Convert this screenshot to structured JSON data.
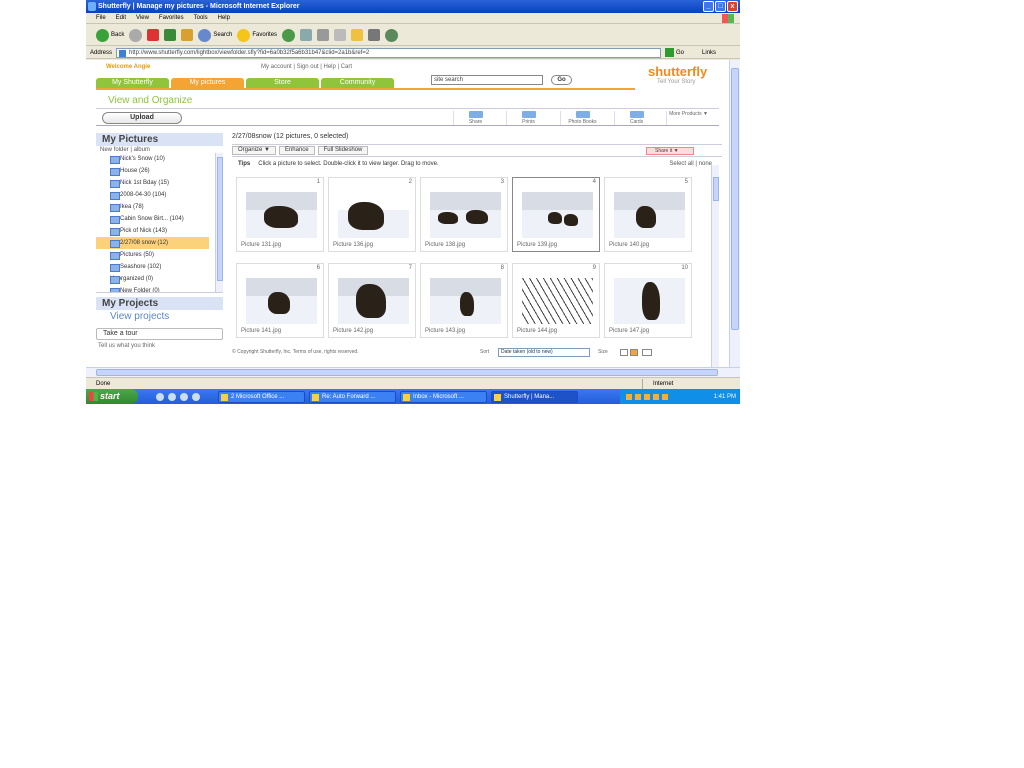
{
  "window": {
    "title": "Shutterfly | Manage my pictures - Microsoft Internet Explorer",
    "minimize": "_",
    "maximize": "□",
    "close": "x"
  },
  "menu": [
    "File",
    "Edit",
    "View",
    "Favorites",
    "Tools",
    "Help"
  ],
  "toolbar": {
    "back": "Back",
    "search": "Search",
    "favorites": "Favorites"
  },
  "address": {
    "label": "Address",
    "url": "http://www.shutterfly.com/lightbox/viewfolder.sfly?fid=6a0b32f5a6b31b47&clid=2a1b&ref=2",
    "go": "Go",
    "links": "Links"
  },
  "page": {
    "welcome": "Welcome Angie",
    "account_links": "My account | Sign out | Help | Cart",
    "tabs": [
      "My Shutterfly",
      "My pictures",
      "Store",
      "Community"
    ],
    "search_placeholder": "site search",
    "go": "Go",
    "logo": "shutterfly",
    "tagline": "Tell Your Story",
    "section_title": "View and Organize",
    "upload": "Upload",
    "actions": [
      "Share",
      "Prints",
      "Photo Books",
      "Cards",
      "More Products ▼"
    ],
    "side": {
      "pictures_title": "My Pictures",
      "sub": "New folder | album",
      "folders": [
        "Nick's Snow (10)",
        "House (26)",
        "Nick 1st Bday (15)",
        "2008-04-30 (104)",
        "Ikea (78)",
        "Cabin Snow Birt... (104)",
        "Pick of Nick (143)",
        "2/27/08 snow (12)",
        "Pictures (50)",
        "Seashore (102)"
      ],
      "new_folder": "Unorganized (0)",
      "new_folder2": "New Folder (0)",
      "projects_title": "My Projects",
      "view_projects": "View projects",
      "tour": "Take a tour",
      "feel": "Tell us what you think"
    },
    "album_title": "2/27/08snow (12 pictures, 0 selected)",
    "buttons": [
      "Organize ▼",
      "Enhance",
      "Full Slideshow"
    ],
    "share_btn": "Share it ▼",
    "tips_label": "Tips",
    "tips": "Click a picture to select. Double-click it to view larger. Drag to move.",
    "select_all": "Select all | none",
    "pictures": [
      {
        "n": "1",
        "cap": "Picture 131.jpg"
      },
      {
        "n": "2",
        "cap": "Picture 136.jpg"
      },
      {
        "n": "3",
        "cap": "Picture 138.jpg"
      },
      {
        "n": "4",
        "cap": "Picture 139.jpg"
      },
      {
        "n": "5",
        "cap": "Picture 140.jpg"
      },
      {
        "n": "6",
        "cap": "Picture 141.jpg"
      },
      {
        "n": "7",
        "cap": "Picture 142.jpg"
      },
      {
        "n": "8",
        "cap": "Picture 143.jpg"
      },
      {
        "n": "9",
        "cap": "Picture 144.jpg"
      },
      {
        "n": "10",
        "cap": "Picture 147.jpg"
      }
    ],
    "footer": "© Copyright Shutterfly, Inc. Terms of use, rights reserved.",
    "sort_label": "Sort",
    "sort_value": "Date taken (old to new)",
    "size_label": "Size"
  },
  "status": {
    "text": "Done",
    "zone": "Internet"
  },
  "taskbar": {
    "start": "start",
    "tasks": [
      "2 Microsoft Office ...",
      "Re: Auto Forward ...",
      "Inbox - Microsoft ...",
      "Shutterfly | Mana..."
    ],
    "clock": "1:41 PM"
  }
}
